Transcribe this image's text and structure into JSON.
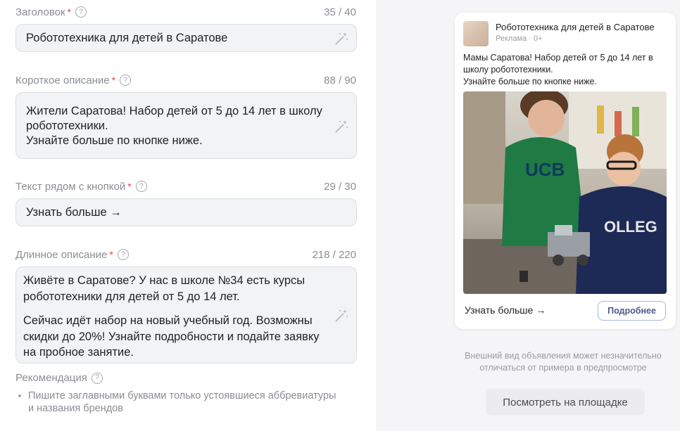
{
  "form": {
    "title_field": {
      "label": "Заголовок",
      "required": "*",
      "help": "?",
      "counter": "35 / 40",
      "value": "Робототехника для детей в Саратове"
    },
    "short_desc": {
      "label": "Короткое описание",
      "required": "*",
      "help": "?",
      "counter": "88 / 90",
      "lines": [
        "Жители Саратова! Набор детей от 5 до 14 лет в школу",
        "робототехники.",
        "Узнайте больше по кнопке ниже."
      ]
    },
    "button_text": {
      "label": "Текст рядом с кнопкой",
      "required": "*",
      "help": "?",
      "counter": "29 / 30",
      "value": "Узнать больше →"
    },
    "long_desc": {
      "label": "Длинное описание",
      "required": "*",
      "help": "?",
      "counter": "218 / 220",
      "para1": [
        "Живёте в Саратове? У нас в школе №34 есть курсы",
        "робототехники для детей от 5 до 14 лет."
      ],
      "para2": [
        "Сейчас идёт набор на новый учебный год. Возможны",
        "скидки до 20%! Узнайте подробности и подайте заявку",
        "на пробное занятие."
      ]
    },
    "recommendation": {
      "title": "Рекомендация",
      "help": "?",
      "lines": [
        "Пишите заглавными буквами только устоявшиеся аббревиатуры",
        "и названия брендов"
      ]
    }
  },
  "preview": {
    "advertiser": "Робототехника для детей в Саратове",
    "meta": "Реклама · 0+",
    "text_lines": [
      "Мамы Саратова! Набор детей от 5 до 14 лет в",
      "школу робототехники.",
      "Узнайте больше по кнопке ниже."
    ],
    "cta_text": "Узнать больше →",
    "more_button": "Подробнее",
    "photo_icon": "kids-robotics-photo",
    "note_lines": [
      "Внешний вид объявления может незначительно",
      "отличаться от примера в предпросмотре"
    ],
    "view_button": "Посмотреть на площадке"
  },
  "colors": {
    "required": "#e64646",
    "field_bg": "#f2f3f5",
    "accent_button_text": "#4a5b8b"
  }
}
